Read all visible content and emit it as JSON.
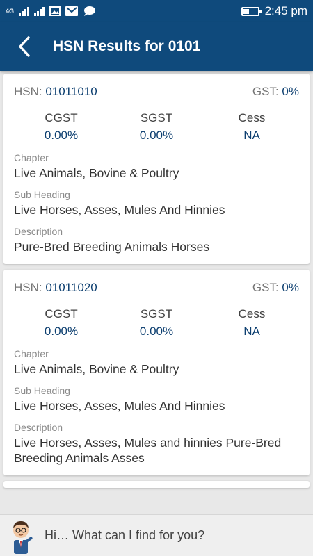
{
  "status": {
    "network": "4G",
    "time": "2:45 pm"
  },
  "appbar": {
    "title": "HSN Results for 0101"
  },
  "results": [
    {
      "hsn_label": "HSN:",
      "hsn_value": "01011010",
      "gst_label": "GST:",
      "gst_value": "0%",
      "cgst_label": "CGST",
      "cgst_value": "0.00%",
      "sgst_label": "SGST",
      "sgst_value": "0.00%",
      "cess_label": "Cess",
      "cess_value": "NA",
      "chapter_label": "Chapter",
      "chapter_value": "Live Animals, Bovine & Poultry",
      "subheading_label": "Sub Heading",
      "subheading_value": "Live Horses, Asses, Mules And Hinnies",
      "description_label": "Description",
      "description_value": "Pure-Bred Breeding Animals Horses"
    },
    {
      "hsn_label": "HSN:",
      "hsn_value": "01011020",
      "gst_label": "GST:",
      "gst_value": "0%",
      "cgst_label": "CGST",
      "cgst_value": "0.00%",
      "sgst_label": "SGST",
      "sgst_value": "0.00%",
      "cess_label": "Cess",
      "cess_value": "NA",
      "chapter_label": "Chapter",
      "chapter_value": "Live Animals, Bovine & Poultry",
      "subheading_label": "Sub Heading",
      "subheading_value": "Live Horses, Asses, Mules And Hinnies",
      "description_label": "Description",
      "description_value": "Live Horses, Asses, Mules and hinnies Pure-Bred Breeding Animals Asses"
    }
  ],
  "assistant": {
    "prompt": "Hi… What can I find for you?"
  },
  "icons": {
    "back": "back-arrow-icon",
    "avatar": "assistant-avatar-icon"
  },
  "colors": {
    "primary": "#0f4a7c",
    "value_blue": "#0d3f70"
  }
}
